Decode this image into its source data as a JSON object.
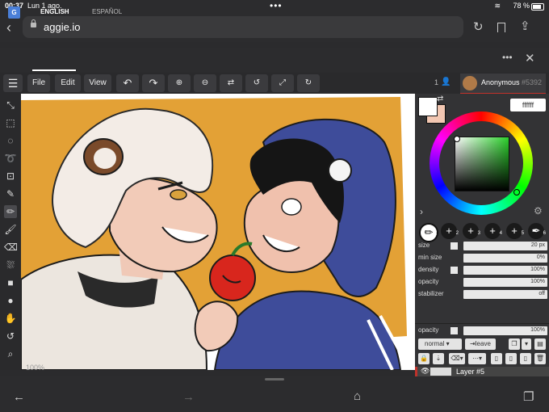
{
  "status": {
    "time": "00:37",
    "date": "Lun 1 ago.",
    "battery": "78 %"
  },
  "browser": {
    "url": "aggie.io"
  },
  "translate": {
    "tab_english": "ENGLISH",
    "tab_spanish": "ESPAÑOL"
  },
  "toolbar": {
    "file": "File",
    "edit": "Edit",
    "view": "View"
  },
  "user": {
    "count": "1",
    "name": "Anonymous",
    "tag": "#5392"
  },
  "color": {
    "hex": "ffffff",
    "primary": "#ffffff",
    "secondary": "#f2c7b2"
  },
  "brushes": [
    "1",
    "2",
    "3",
    "4",
    "5",
    "6"
  ],
  "sliders": {
    "size_label": "size",
    "size_value": "20 px",
    "minsize_label": "min size",
    "minsize_value": "0%",
    "density_label": "density",
    "density_value": "100%",
    "opacity_label": "opacity",
    "opacity_value": "100%",
    "stabilizer_label": "stabilizer",
    "stabilizer_value": "off"
  },
  "layers": {
    "opacity_label": "opacity",
    "opacity_value": "100%",
    "blend_mode": "normal",
    "leave_label": "leave",
    "current_layer": "Layer #5"
  },
  "canvas": {
    "zoom": "100%"
  }
}
